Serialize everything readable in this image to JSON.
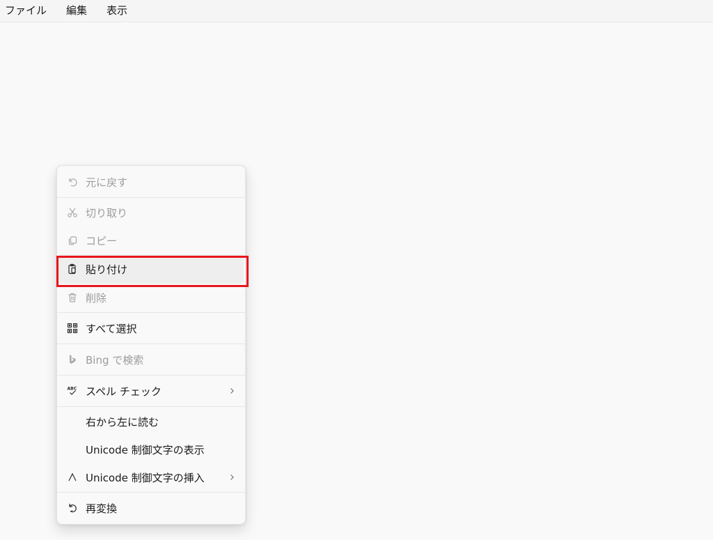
{
  "menubar": {
    "items": [
      "ファイル",
      "編集",
      "表示"
    ]
  },
  "context_menu": {
    "items": [
      {
        "label": "元に戻す",
        "icon": "undo-icon",
        "enabled": false
      },
      {
        "label": "切り取り",
        "icon": "cut-icon",
        "enabled": false
      },
      {
        "label": "コピー",
        "icon": "copy-icon",
        "enabled": false
      },
      {
        "label": "貼り付け",
        "icon": "paste-icon",
        "enabled": true,
        "highlighted": true
      },
      {
        "label": "削除",
        "icon": "delete-icon",
        "enabled": false
      },
      {
        "label": "すべて選択",
        "icon": "select-all-icon",
        "enabled": true
      },
      {
        "label": "Bing で検索",
        "icon": "bing-icon",
        "enabled": false
      },
      {
        "label": "スペル チェック",
        "icon": "spellcheck-icon",
        "enabled": true,
        "submenu": true
      },
      {
        "label": "右から左に読む",
        "icon": "",
        "enabled": true
      },
      {
        "label": "Unicode 制御文字の表示",
        "icon": "",
        "enabled": true
      },
      {
        "label": "Unicode 制御文字の挿入",
        "icon": "caret-icon",
        "enabled": true,
        "submenu": true
      },
      {
        "label": "再変換",
        "icon": "reconvert-icon",
        "enabled": true
      }
    ]
  },
  "colors": {
    "highlight_border": "#e8161c",
    "disabled_text": "#9c9c9c",
    "background": "#f9f9f9"
  }
}
